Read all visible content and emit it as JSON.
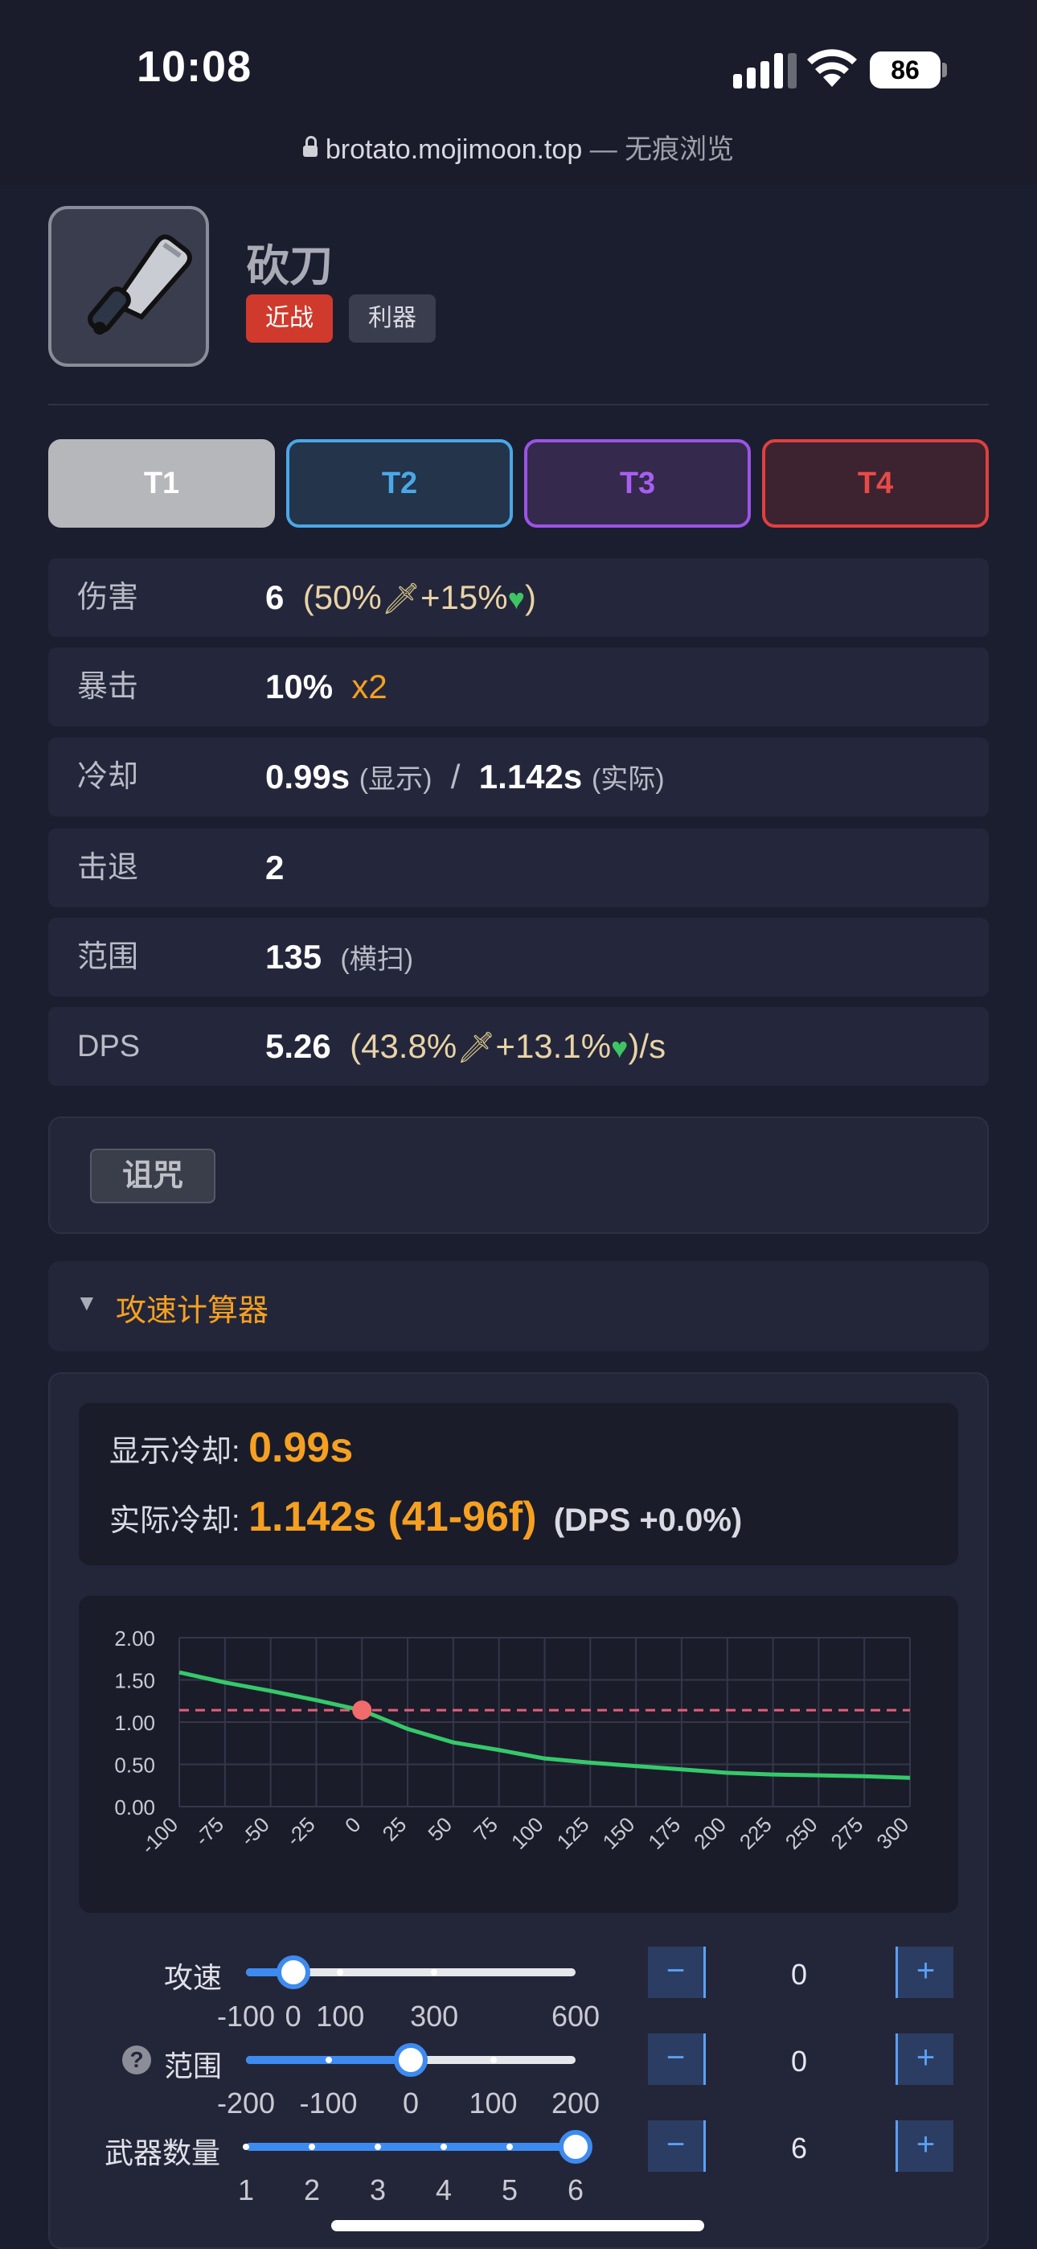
{
  "status": {
    "time": "10:08",
    "battery": "86"
  },
  "url": {
    "host": "brotato.mojimoon.top",
    "mode": " — 无痕浏览"
  },
  "weapon": {
    "name": "砍刀",
    "tags": [
      "近战",
      "利器"
    ],
    "icon": "cleaver-icon"
  },
  "tiers": [
    "T1",
    "T2",
    "T3",
    "T4"
  ],
  "stats": {
    "damage": {
      "label": "伤害",
      "value": "6",
      "scaling": "(50%",
      "scaling2": "+15%",
      "close": ")"
    },
    "crit": {
      "label": "暴击",
      "value": "10%",
      "mult": "x2"
    },
    "cooldown": {
      "label": "冷却",
      "shown": "0.99s",
      "shown_note": "(显示)",
      "sep": "/",
      "actual": "1.142s",
      "actual_note": "(实际)"
    },
    "knockback": {
      "label": "击退",
      "value": "2"
    },
    "range": {
      "label": "范围",
      "value": "135",
      "note": "(横扫)"
    },
    "dps": {
      "label": "DPS",
      "value": "5.26",
      "scaling": "(43.8%",
      "scaling2": "+13.1%",
      "close": ")/s"
    }
  },
  "curse_button": "诅咒",
  "calc": {
    "title": "攻速计算器",
    "shown_label": "显示冷却:",
    "shown_value": "0.99s",
    "actual_label": "实际冷却:",
    "actual_value": "1.142s (41-96f)",
    "dps_delta": "(DPS +0.0%)"
  },
  "chart_data": {
    "type": "line",
    "x": [
      -100,
      -75,
      -50,
      -25,
      0,
      25,
      50,
      75,
      100,
      125,
      150,
      175,
      200,
      225,
      250,
      275,
      300
    ],
    "series": [
      {
        "values": [
          1.59,
          1.47,
          1.37,
          1.26,
          1.14,
          0.92,
          0.76,
          0.67,
          0.57,
          0.52,
          0.48,
          0.44,
          0.4,
          0.38,
          0.37,
          0.36,
          0.34
        ]
      }
    ],
    "reference_line": 1.142,
    "marker": {
      "x": 0,
      "y": 1.142
    },
    "y_ticks": [
      "2.00",
      "1.50",
      "1.00",
      "0.50",
      "0.00"
    ],
    "x_ticks": [
      "-100",
      "-75",
      "-50",
      "-25",
      "0",
      "25",
      "50",
      "75",
      "100",
      "125",
      "150",
      "175",
      "200",
      "225",
      "250",
      "275",
      "300"
    ],
    "ylim": [
      0,
      2
    ],
    "xlim": [
      -100,
      300
    ],
    "grid": true,
    "colors": {
      "line": "#35c96a",
      "reference": "#e0607a",
      "marker": "#f06b6b"
    }
  },
  "sliders": {
    "atk_speed": {
      "label": "攻速",
      "value": "0",
      "min": -100,
      "max": 600,
      "current": 0,
      "ticks": [
        "-100",
        "0",
        "100",
        "300",
        "600"
      ]
    },
    "range": {
      "label": "范围",
      "value": "0",
      "min": -200,
      "max": 200,
      "current": 0,
      "ticks": [
        "-200",
        "-100",
        "0",
        "100",
        "200"
      ]
    },
    "weapon_count": {
      "label": "武器数量",
      "value": "6",
      "min": 1,
      "max": 6,
      "current": 6,
      "ticks": [
        "1",
        "2",
        "3",
        "4",
        "5",
        "6"
      ]
    }
  },
  "stepper": {
    "minus": "−",
    "plus": "+"
  },
  "help_icon": "?"
}
